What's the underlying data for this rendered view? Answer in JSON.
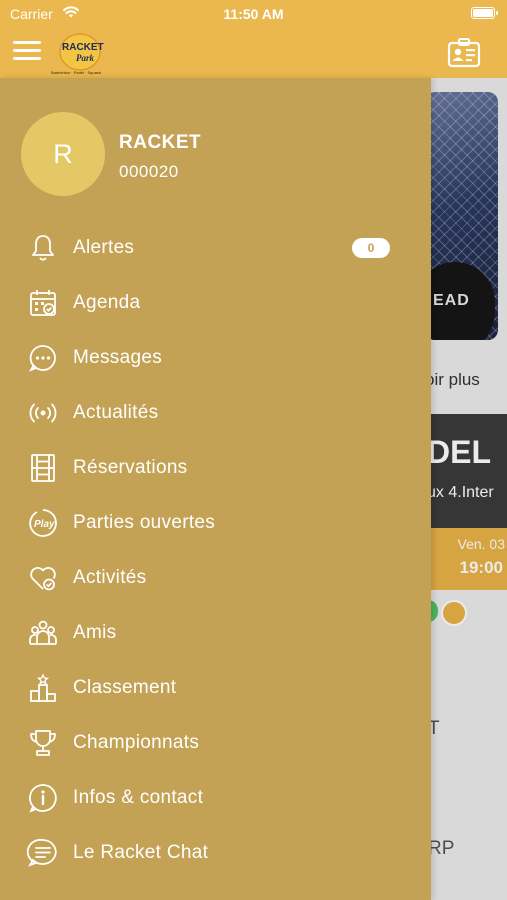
{
  "status_bar": {
    "carrier": "Carrier",
    "time": "11:50 AM"
  },
  "app": {
    "logo_text_1": "RACKET",
    "logo_text_2": "Park",
    "logo_subtitle": "Badminton · Padel · Squash",
    "brand_color": "#eab84e"
  },
  "drawer": {
    "background_color": "#c4a255",
    "user": {
      "initial": "R",
      "name": "RACKET",
      "id": "000020"
    },
    "menu": [
      {
        "label": "Alertes",
        "icon": "bell-icon",
        "badge": "0"
      },
      {
        "label": "Agenda",
        "icon": "calendar-check-icon"
      },
      {
        "label": "Messages",
        "icon": "chat-bubble-icon"
      },
      {
        "label": "Actualités",
        "icon": "broadcast-icon"
      },
      {
        "label": "Réservations",
        "icon": "court-icon"
      },
      {
        "label": "Parties ouvertes",
        "icon": "play-badge-icon"
      },
      {
        "label": "Activités",
        "icon": "heart-check-icon"
      },
      {
        "label": "Amis",
        "icon": "group-icon"
      },
      {
        "label": "Classement",
        "icon": "podium-icon"
      },
      {
        "label": "Championnats",
        "icon": "trophy-icon"
      },
      {
        "label": "Infos & contact",
        "icon": "info-icon"
      },
      {
        "label": "Le Racket Chat",
        "icon": "chat-lines-icon"
      }
    ]
  },
  "background": {
    "photo_brand": "EAD",
    "voir_plus": "oir plus",
    "card_title": "DEL",
    "card_subtitle": "ux 4.Inter",
    "date": "Ven. 03",
    "time": "19:00",
    "text_t": "T",
    "text_rp": "RP"
  }
}
